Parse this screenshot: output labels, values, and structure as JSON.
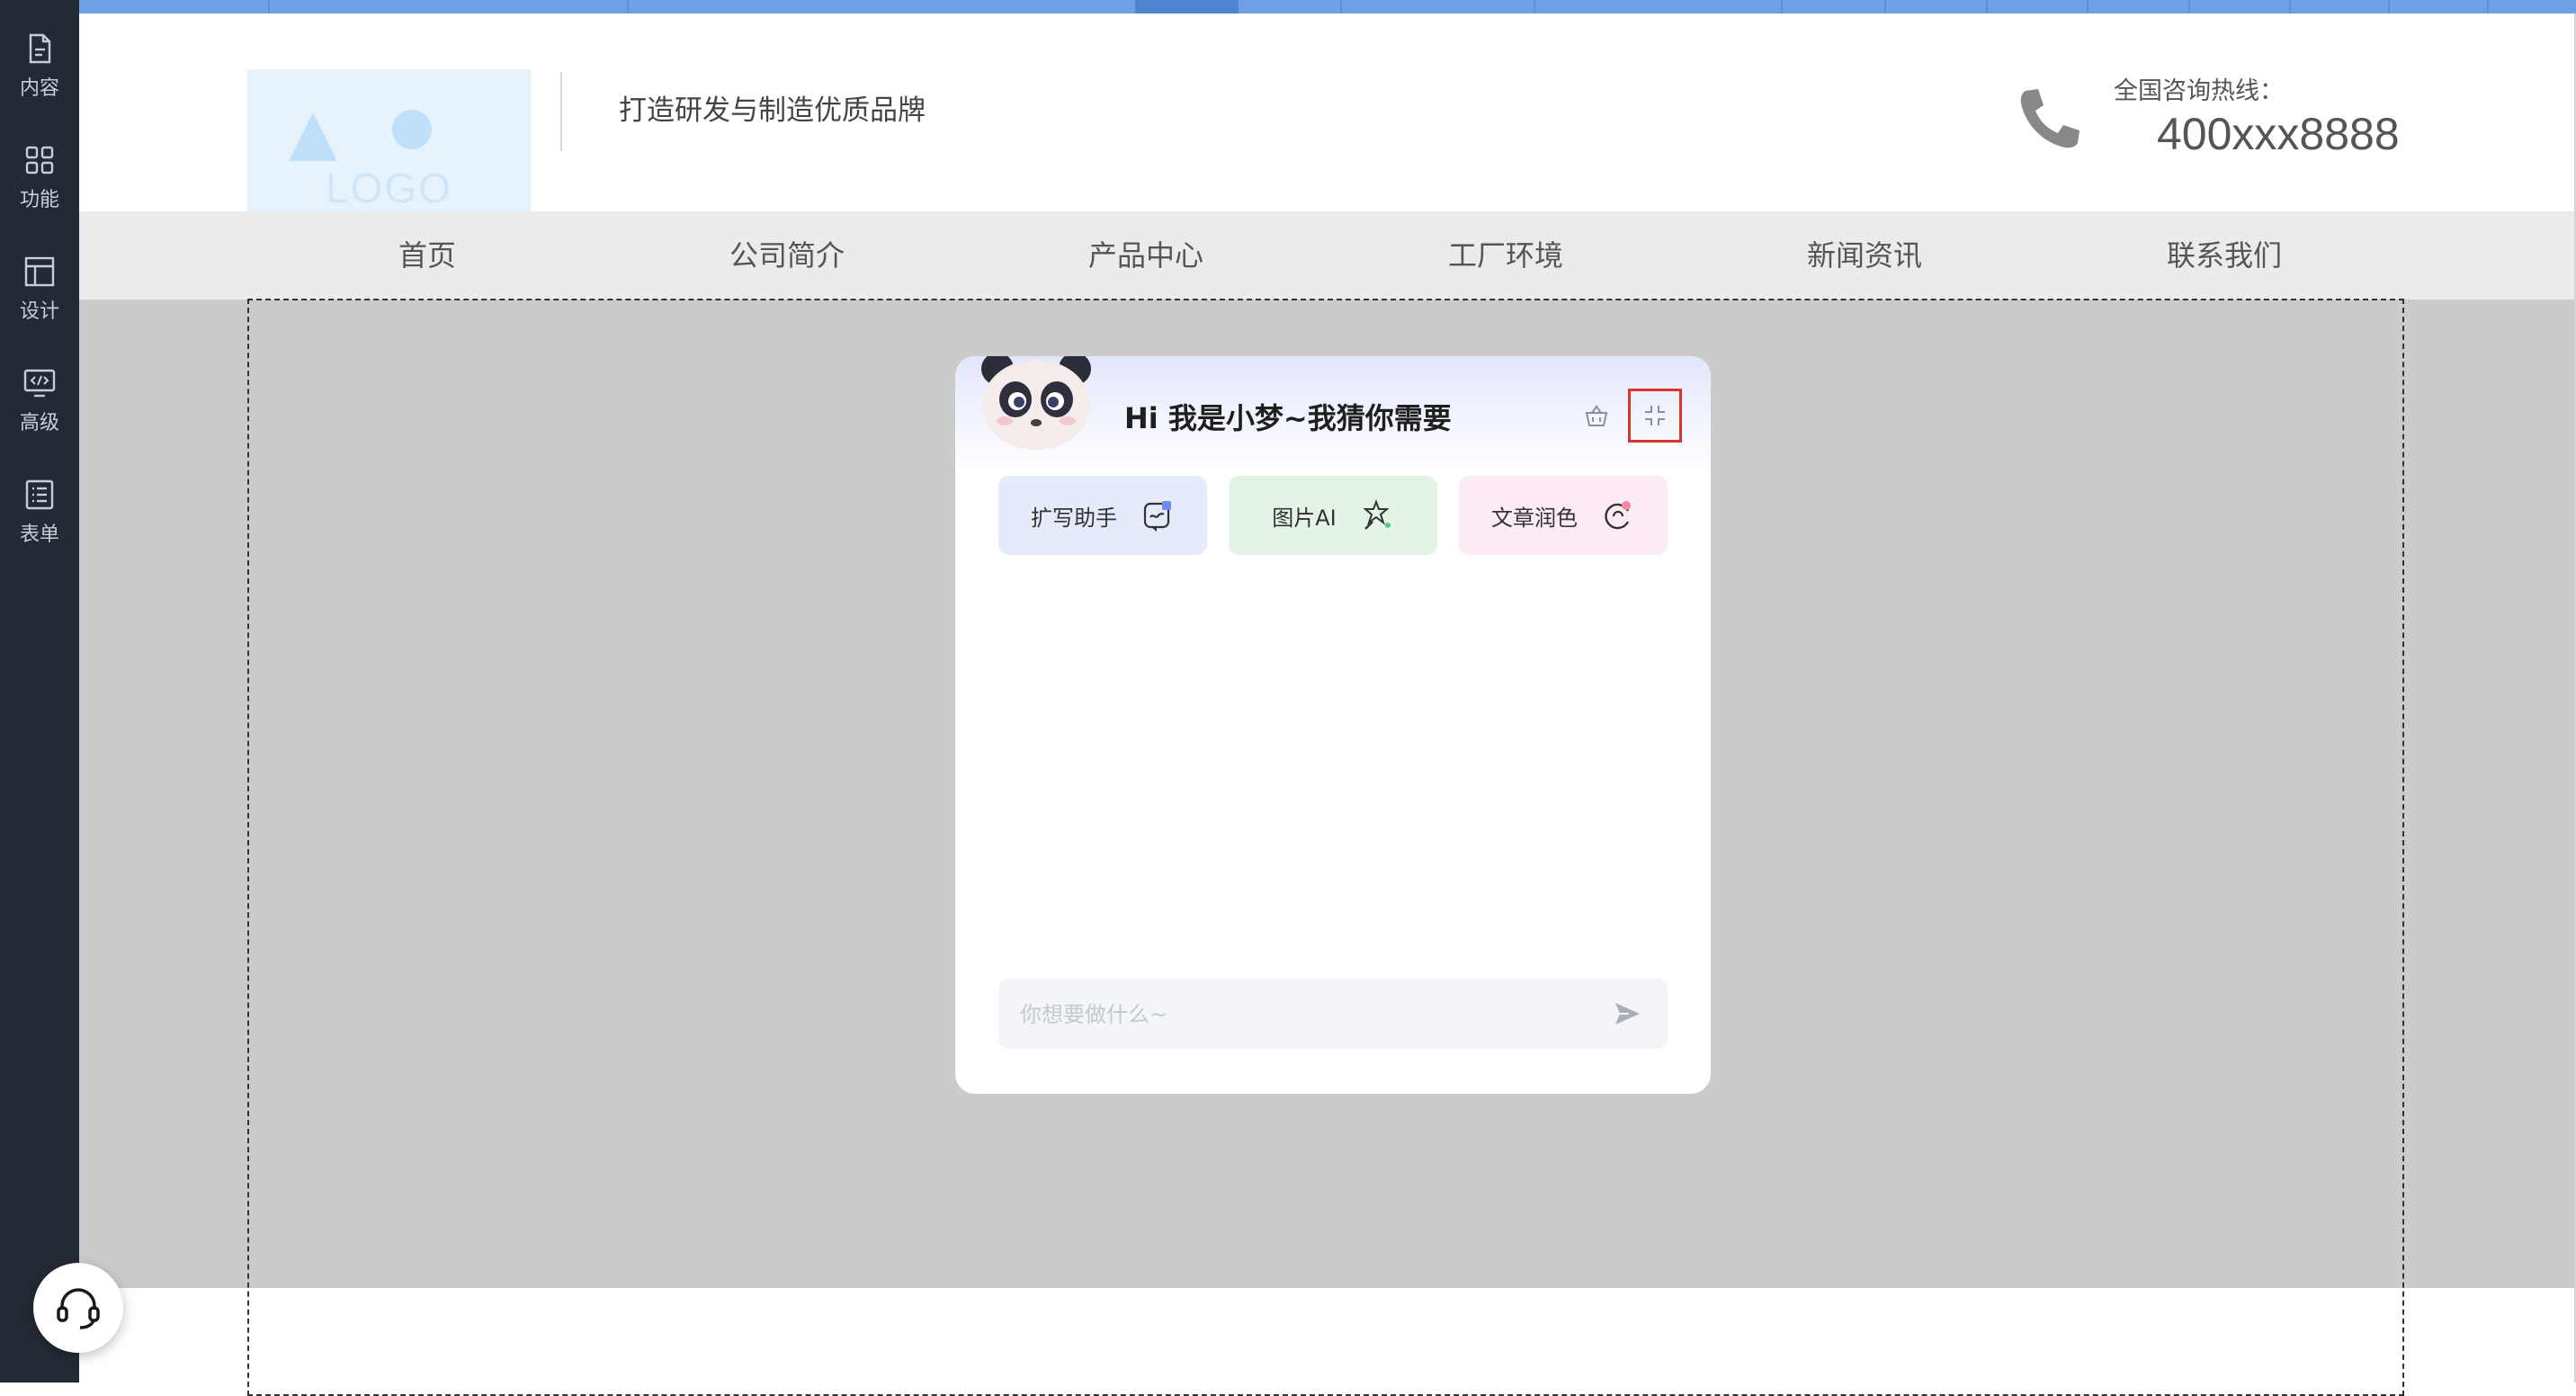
{
  "sidebar": {
    "items": [
      {
        "label": "内容",
        "icon": "document-icon"
      },
      {
        "label": "功能",
        "icon": "grid-icon"
      },
      {
        "label": "设计",
        "icon": "layout-icon"
      },
      {
        "label": "高级",
        "icon": "code-monitor-icon"
      },
      {
        "label": "表单",
        "icon": "form-icon"
      }
    ],
    "support_icon": "headset-icon"
  },
  "header": {
    "logo_text": "LOGO",
    "slogan": "打造研发与制造优质品牌",
    "hotline_label": "全国咨询热线：",
    "hotline_number": "400xxx8888"
  },
  "nav": {
    "items": [
      "首页",
      "公司简介",
      "产品中心",
      "工厂环境",
      "新闻资讯",
      "联系我们"
    ]
  },
  "chat": {
    "title": "Hi 我是小梦~我猜你需要",
    "chips": [
      {
        "label": "扩写助手",
        "color": "#e6ebfb"
      },
      {
        "label": "图片AI",
        "color": "#e3f3e6"
      },
      {
        "label": "文章润色",
        "color": "#fcebf4"
      }
    ],
    "input_placeholder": "你想要做什么~",
    "input_value": ""
  },
  "colors": {
    "sidebar_bg": "#232a36",
    "accent_strip": "#6fa0e6",
    "nav_bg": "#ebebeb",
    "canvas_bg": "#cbcbcb",
    "active_outline": "#d8352b"
  }
}
